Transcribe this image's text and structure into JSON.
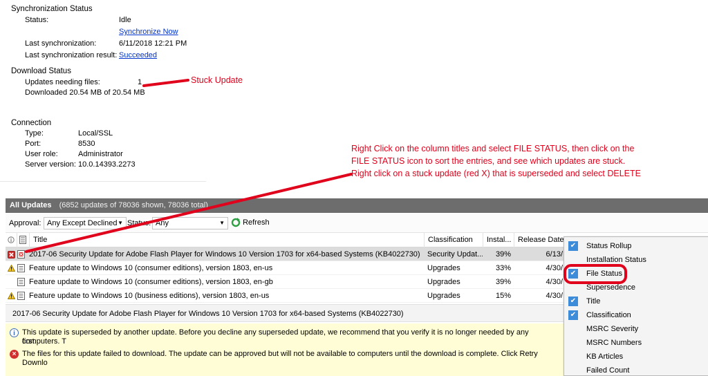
{
  "sync": {
    "heading": "Synchronization Status",
    "status_label": "Status:",
    "status_value": "Idle",
    "sync_now_link": "Synchronize Now",
    "last_sync_label": "Last synchronization:",
    "last_sync_value": "6/11/2018 12:21 PM",
    "last_result_label": "Last synchronization result:",
    "last_result_link": "Succeeded"
  },
  "download": {
    "heading": "Download Status",
    "needing_label": "Updates needing files:",
    "needing_value": "1",
    "downloaded_text": "Downloaded 20.54 MB of 20.54 MB"
  },
  "connection": {
    "heading": "Connection",
    "type_label": "Type:",
    "type_value": "Local/SSL",
    "port_label": "Port:",
    "port_value": "8530",
    "role_label": "User role:",
    "role_value": "Administrator",
    "version_label": "Server version:",
    "version_value": "10.0.14393.2273"
  },
  "annotations": {
    "stuck_label": "Stuck Update",
    "instruction_line1": "Right Click on the column titles and select FILE STATUS, then click on the",
    "instruction_line2": "FILE STATUS icon to sort the entries, and see which updates are stuck.",
    "instruction_line3": "Right click on a stuck update (red X) that is superseded and select DELETE",
    "color": "#e0001b"
  },
  "panel": {
    "title": "All Updates",
    "count_text": "(6852 updates of 78036 shown, 78036 total)",
    "approval_label": "Approval:",
    "approval_value": "Any Except Declined",
    "status_label": "Status:",
    "status_value": "Any",
    "refresh_label": "Refresh"
  },
  "columns": {
    "title": "Title",
    "classification": "Classification",
    "installed": "Instal...",
    "release_date": "Release Date"
  },
  "rows": [
    {
      "title": "2017-06 Security Update for Adobe Flash Player for Windows 10 Version 1703 for x64-based Systems (KB4022730)",
      "classification": "Security Updat...",
      "installed": "39%",
      "release": "6/13/",
      "status_icon": "error-x-icon"
    },
    {
      "title": "Feature update to Windows 10 (consumer editions), version 1803, en-us",
      "classification": "Upgrades",
      "installed": "33%",
      "release": "4/30/",
      "status_icon": "warning-icon"
    },
    {
      "title": "Feature update to Windows 10 (consumer editions), version 1803, en-gb",
      "classification": "Upgrades",
      "installed": "39%",
      "release": "4/30/",
      "status_icon": "none"
    },
    {
      "title": "Feature update to Windows 10 (business editions), version 1803, en-us",
      "classification": "Upgrades",
      "installed": "15%",
      "release": "4/30/",
      "status_icon": "warning-icon"
    }
  ],
  "detail": {
    "title": "2017-06 Security Update for Adobe Flash Player for Windows 10 Version 1703 for x64-based Systems (KB4022730)",
    "info_line1": "This update is superseded by another update. Before you decline any superseded update, we recommend that you verify it is no longer needed by any computers. T",
    "info_line2": "first.",
    "error_line": "The files for this update failed to download. The update can be approved but will not be available to computers until the download is complete. Click Retry Downlo"
  },
  "context_menu": {
    "items": [
      {
        "label": "Status Rollup",
        "checked": true
      },
      {
        "label": "Installation Status",
        "checked": false
      },
      {
        "label": "File Status",
        "checked": true
      },
      {
        "label": "Supersedence",
        "checked": false
      },
      {
        "label": "Title",
        "checked": true
      },
      {
        "label": "Classification",
        "checked": true
      },
      {
        "label": "MSRC Severity",
        "checked": false
      },
      {
        "label": "MSRC Numbers",
        "checked": false
      },
      {
        "label": "KB Articles",
        "checked": false
      },
      {
        "label": "Failed Count",
        "checked": false
      }
    ]
  }
}
